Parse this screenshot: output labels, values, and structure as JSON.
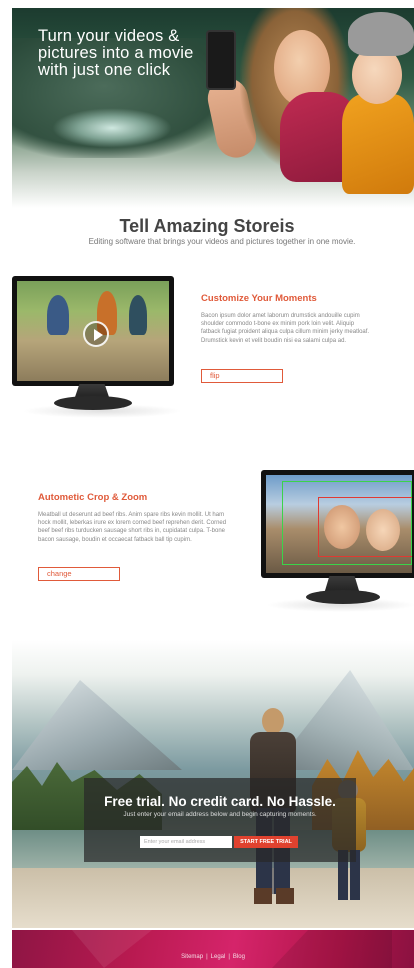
{
  "hero": {
    "title": "Turn your videos & pictures into a movie with just one click"
  },
  "tagline": {
    "title": "Tell Amazing Storeis",
    "subtitle": "Editing software that brings your videos and pictures together in one movie."
  },
  "features": [
    {
      "title": "Customize Your Moments",
      "body": "Bacon ipsum dolor amet laborum drumstick andouille cupim shoulder commodo t-bone ex minim pork loin velit. Aliquip fatback fugiat proident aliqua culpa cillum minim jerky meatloaf. Drumstick kevin et velit boudin nisi ea salami culpa ad.",
      "button_label": "flip"
    },
    {
      "title": "Autometic Crop & Zoom",
      "body": "Meatball ut deserunt ad beef ribs. Anim spare ribs kevin mollit. Ut ham hock mollit, leberkas irure ex lorem corned beef reprehen derit. Corned beef beef ribs turducken sausage short ribs in, cupidatat culpa. T-bone bacon sausage, boudin et occaecat fatback ball tip cupim.",
      "button_label": "change"
    }
  ],
  "trial": {
    "title": "Free trial. No credit card. No Hassle.",
    "subtitle": "Just enter your email address below and begin capturing moments.",
    "email_placeholder": "Enter your email address",
    "button_label": "START FREE TRIAL"
  },
  "footer": {
    "links": [
      "Sitemap",
      "Legal",
      "Blog"
    ],
    "separator": "|"
  },
  "colors": {
    "accent": "#e05a3a",
    "cta": "#e0422f",
    "footer": "#b81a50"
  }
}
